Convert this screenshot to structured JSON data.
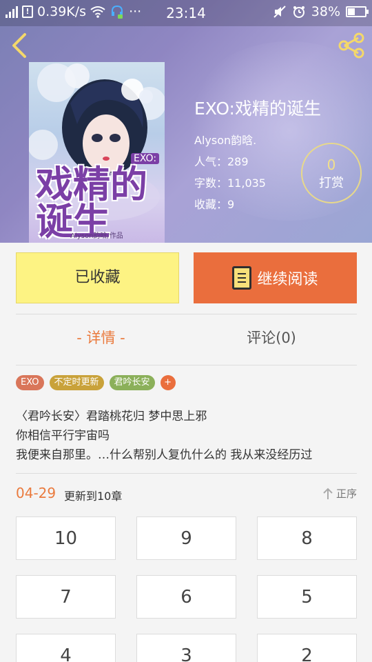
{
  "status_bar": {
    "net_speed": "0.39K/s",
    "time": "23:14",
    "battery": "38%",
    "sim_label": "2G"
  },
  "book": {
    "title": "EXO:戏精的诞生",
    "author": "Alyson韵晗.",
    "popularity": "人气：289",
    "word_count": "字数：11,035",
    "favorites": "收藏：9",
    "cover_title": "戏精的诞生",
    "cover_tag": "EXO:",
    "cover_credit": "Alyson韵晗/作品"
  },
  "tip": {
    "count": "0",
    "label": "打赏"
  },
  "actions": {
    "favorited": "已收藏",
    "continue_reading": "继续阅读"
  },
  "tabs": {
    "detail": "- 详情 -",
    "comments": "评论(0)"
  },
  "tags": [
    {
      "label": "EXO",
      "color": "#d9765a"
    },
    {
      "label": "不定时更新",
      "color": "#c9a23a"
    },
    {
      "label": "君吟长安",
      "color": "#8bb05a"
    }
  ],
  "tag_more": "+",
  "synopsis": [
    "〈君吟长安〉君踏桃花归 梦中思上邪",
    "你相信平行宇宙吗",
    "我便来自那里。…什么帮别人复仇什么的 我从来没经历过"
  ],
  "update": {
    "date": "04-29",
    "text": "更新到10章",
    "sort_label": "正序"
  },
  "chapters": [
    "10",
    "9",
    "8",
    "7",
    "6",
    "5",
    "4",
    "3",
    "2"
  ],
  "colors": {
    "accent": "#ea6e3d",
    "favorite_bg": "#fdf383"
  }
}
